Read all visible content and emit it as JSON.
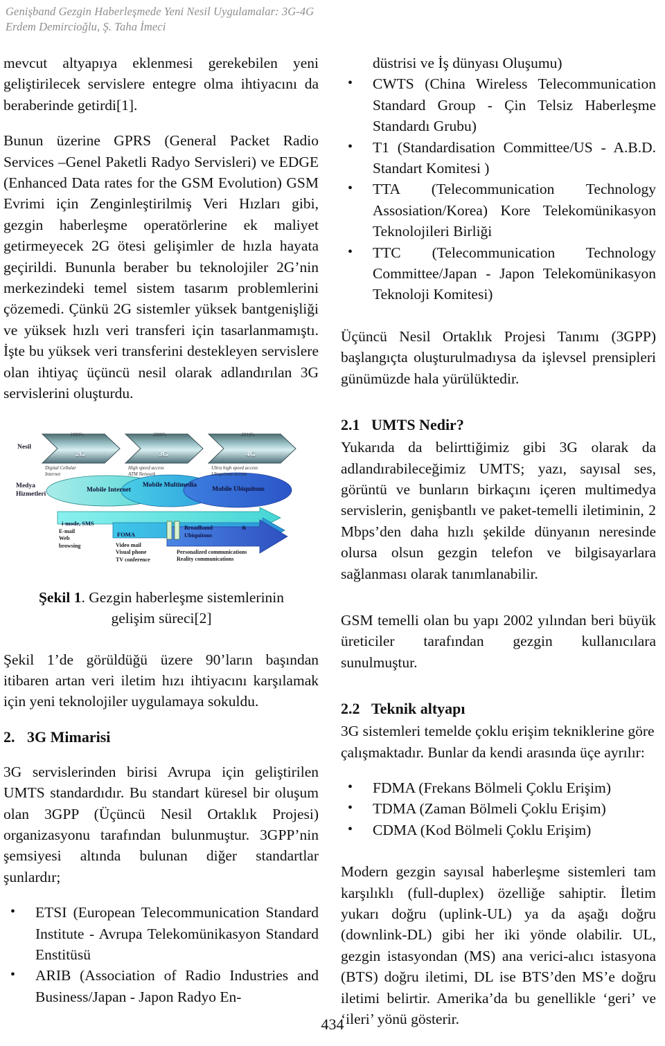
{
  "running_header": {
    "line1": "Genişband Gezgin Haberleşmede Yeni Nesil Uygulamalar: 3G-4G",
    "line2": "Erdem Demircioğlu, Ş. Taha İmeci"
  },
  "left_column": {
    "para_continued": "mevcut altyapıya eklenmesi gerekebilen yeni geliştirilecek servislere entegre olma  ihtiyacını da beraberinde getirdi[1].",
    "para_gprs": "Bunun üzerine GPRS (General Packet Radio Services –Genel Paketli Radyo Servisleri)  ve EDGE (Enhanced Data rates for the GSM Evolution)  GSM Evrimi için Zenginleştirilmiş Veri Hızları gibi, gezgin haberleşme operatörlerine ek maliyet getirmeyecek 2G ötesi gelişimler de hızla hayata geçirildi. Bununla beraber bu teknolojiler 2G’nin merkezindeki temel sistem tasarım problemlerini çözemedi. Çünkü 2G sistemler yüksek bantgenişliği ve yüksek hızlı veri transferi için tasarlanmamıştı. İşte bu yüksek veri transferini destekleyen servislere olan ihtiyaç üçüncü nesil olarak adlandırılan 3G servislerini oluşturdu.",
    "figure_caption_label": "Şekil 1",
    "figure_caption_text": ". Gezgin haberleşme sistemlerinin gelişim süreci[2]",
    "para_sekil": "Şekil 1’de görüldüğü üzere 90’ların başından itibaren artan veri iletim hızı ihtiyacını karşılamak için yeni teknolojiler uygulamaya sokuldu.",
    "heading_3g": {
      "number": "2.",
      "title": "3G Mimarisi"
    },
    "para_umts": "3G servislerinden birisi Avrupa için geliştirilen UMTS standardıdır. Bu standart küresel bir oluşum olan 3GPP (Üçüncü Nesil Ortaklık Projesi) organizasyonu tarafından bulunmuştur. 3GPP’nin şemsiyesi altında bulunan diğer standartlar şunlardır;",
    "bullets": [
      "ETSI (European Telecommunication Standard Institute - Avrupa Telekomünikasyon Standard Enstitüsü",
      "ARIB (Association of Radio Industries and Business/Japan - Japon Radyo En-"
    ]
  },
  "right_column": {
    "bullet_continuation": "düstrisi ve İş dünyası Oluşumu)",
    "bullets": [
      "CWTS (China Wireless Telecommunication Standard Group - Çin Telsiz Haberleşme Standardı Grubu)",
      "T1 (Standardisation Committee/US - A.B.D. Standart Komitesi )",
      "TTA (Telecommunication Technology Assosiation/Korea) Kore Telekomünikasyon Teknolojileri Birliği",
      "TTC (Telecommunication Technology Committee/Japan - Japon Telekomünikasyon Teknoloji Komitesi)"
    ],
    "para_3gpp": "Üçüncü Nesil Ortaklık Projesi Tanımı (3GPP) başlangıçta oluşturulmadıysa da işlevsel prensipleri günümüzde hala yürülüktedir.",
    "heading_umts": {
      "number": "2.1",
      "title": "UMTS Nedir?"
    },
    "para_umts_def": "Yukarıda da belirttiğimiz gibi 3G olarak da adlandırabileceğimiz UMTS; yazı, sayısal ses, görüntü ve bunların birkaçını içeren multimedya servislerin, genişbantlı ve paket-temelli iletiminin, 2 Mbps’den daha hızlı şekilde dünyanın neresinde olursa olsun gezgin telefon ve bilgisayarlara sağlanması olarak tanımlanabilir.",
    "para_gsm": "GSM temelli olan bu yapı 2002 yılından beri büyük üreticiler tarafından gezgin kullanıcılara sunulmuştur.",
    "heading_teknik": {
      "number": "2.2",
      "title": "Teknik altyapı"
    },
    "para_teknik": "3G sistemleri temelde çoklu erişim tekniklerine göre çalışmaktadır. Bunlar da kendi arasında üçe ayrılır:",
    "access_bullets": [
      "FDMA (Frekans Bölmeli Çoklu Erişim)",
      "TDMA (Zaman Bölmeli Çoklu Erişim)",
      "CDMA (Kod Bölmeli Çoklu Erişim)"
    ],
    "para_duplex": "Modern gezgin sayısal haberleşme sistemleri tam karşılıklı (full-duplex) özelliğe sahiptir. İletim yukarı doğru (uplink-UL) ya da aşağı doğru (downlink-DL) gibi her iki yönde olabilir. UL, gezgin istasyondan (MS) ana verici-alıcı istasyona (BTS) doğru iletimi, DL ise BTS’den MS’e doğru iletimi belirtir. Amerika’da bu genellikle ‘geri’ ve ‘ileri’ yönü gösterir."
  },
  "figure": {
    "row_label_1": "Nesil",
    "row_label_2a": "Medya",
    "row_label_2b": "Hizmetleri",
    "years": [
      "1990's",
      "2000's",
      "2010's"
    ],
    "generations": [
      "2G",
      "3G",
      "4G"
    ],
    "gen_captions": [
      "Digital Cellular\nInternet",
      "High speed access\nATM Network",
      "Ultra high speed access\nUbiquitous access"
    ],
    "ellipses": [
      "Mobile Internet",
      "Mobile Multimedia",
      "Mobile Ubiquitous"
    ],
    "bar_labels": [
      "i-mode, SMS",
      "FOMA",
      "Broadband & Ubiquitous"
    ],
    "service_lists": [
      "E-mail\nWeb\nbrowsing",
      "Video mail\nVisual phone\nTV conference",
      "Personalized communications\nReality communications"
    ],
    "colors": {
      "chevron_dark": "#5d7c80",
      "chevron_light": "#cfe6e8",
      "cyan": "#6fe0e0",
      "blue": "#3a6fd8",
      "mid_blue": "#2ca8e0"
    }
  },
  "page_number": "434"
}
